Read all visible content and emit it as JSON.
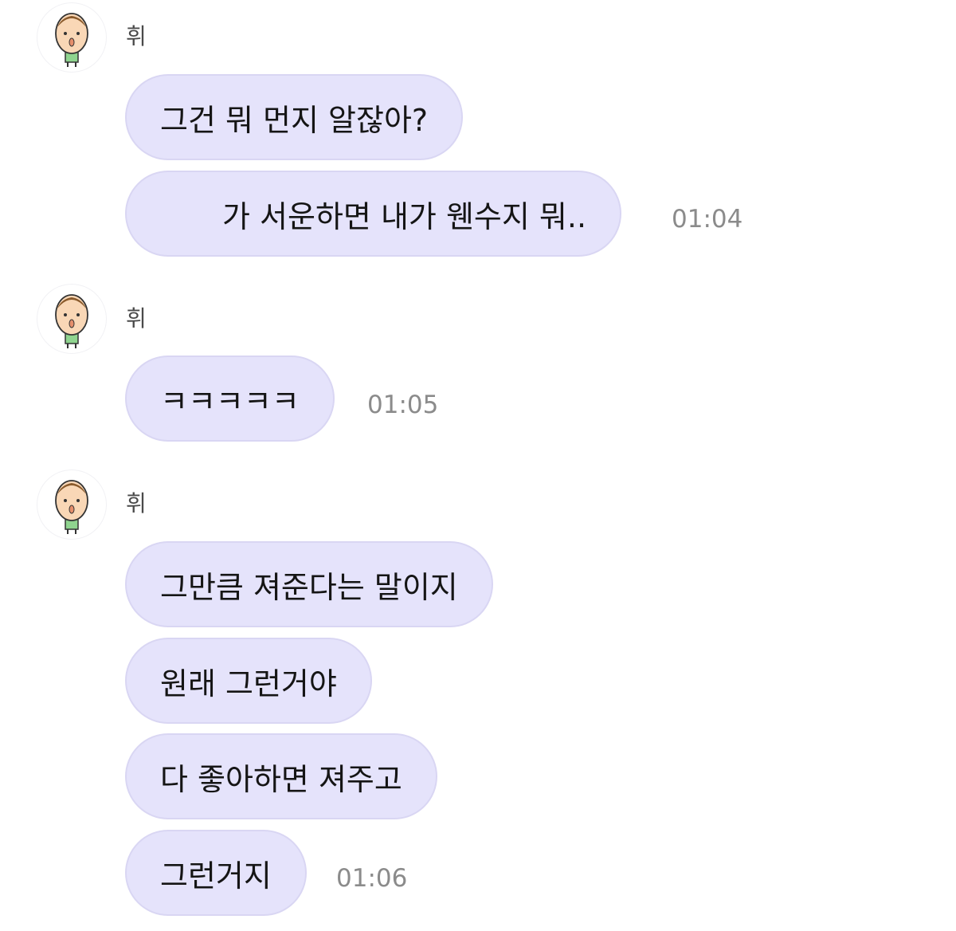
{
  "chat": {
    "groups": [
      {
        "sender": "휘",
        "avatar_icon": "cartoon-boy-avatar-icon",
        "messages": [
          "그건 뭐 먼지 알잖아?",
          "가 서운하면 내가 웬수지 뭐.."
        ],
        "time": "01:04"
      },
      {
        "sender": "휘",
        "avatar_icon": "cartoon-boy-avatar-icon",
        "messages": [
          "ㅋㅋㅋㅋㅋ"
        ],
        "time": "01:05"
      },
      {
        "sender": "휘",
        "avatar_icon": "cartoon-boy-avatar-icon",
        "messages": [
          "그만큼 져준다는 말이지",
          "원래 그런거야",
          "다 좋아하면 져주고",
          "그런거지"
        ],
        "time": "01:06"
      }
    ]
  },
  "colors": {
    "bubble_fill": "#e5e3fb",
    "bubble_border": "#d9d6f3",
    "timestamp": "#8b8b8b",
    "sender_name": "#4a4a4a"
  }
}
